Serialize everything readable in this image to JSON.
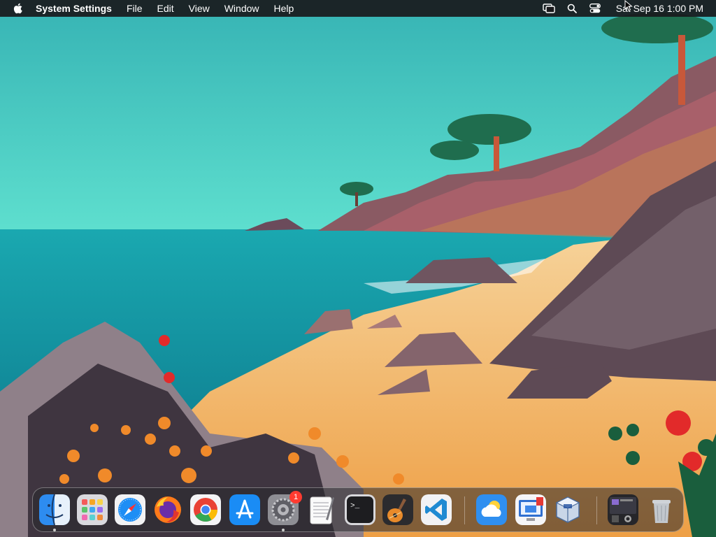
{
  "menubar": {
    "app_name": "System Settings",
    "menus": [
      "File",
      "Edit",
      "Window",
      "Help"
    ],
    "view_label": "View",
    "clock": "Sat Sep 16  1:00 PM",
    "status_icons": [
      "screen-mirroring-icon",
      "spotlight-search-icon",
      "control-center-icon"
    ]
  },
  "dock": {
    "apps": [
      {
        "name": "Finder",
        "icon": "finder-icon",
        "running": true
      },
      {
        "name": "Launchpad",
        "icon": "launchpad-icon",
        "running": false
      },
      {
        "name": "Safari",
        "icon": "safari-icon",
        "running": false
      },
      {
        "name": "Firefox",
        "icon": "firefox-icon",
        "running": false
      },
      {
        "name": "Chrome",
        "icon": "chrome-icon",
        "running": false
      },
      {
        "name": "App Store",
        "icon": "app-store-icon",
        "running": false
      },
      {
        "name": "System Settings",
        "icon": "system-settings-icon",
        "running": true,
        "badge": "1"
      },
      {
        "name": "TextEdit",
        "icon": "textedit-icon",
        "running": false
      },
      {
        "name": "Terminal",
        "icon": "terminal-icon",
        "running": false
      },
      {
        "name": "GarageBand",
        "icon": "garageband-icon",
        "running": false
      },
      {
        "name": "Visual Studio Code",
        "icon": "vscode-icon",
        "running": false
      },
      {
        "name": "Weather",
        "icon": "weather-icon",
        "running": false
      },
      {
        "name": "Remote Desktop",
        "icon": "remote-desktop-icon",
        "running": false
      },
      {
        "name": "VirtualBox",
        "icon": "virtualbox-icon",
        "running": false
      },
      {
        "name": "Downloads",
        "icon": "downloads-stack-icon",
        "running": false
      },
      {
        "name": "Trash",
        "icon": "trash-icon",
        "running": false
      }
    ],
    "badge_text": "1",
    "terminal_prompt": ">_"
  },
  "colors": {
    "sky": "#3fc0bd",
    "sea": "#0f8a96",
    "sand": "#f2c27a",
    "rock": "#5e4a55",
    "menubar": "#19191c",
    "badge": "#ff3b30"
  }
}
